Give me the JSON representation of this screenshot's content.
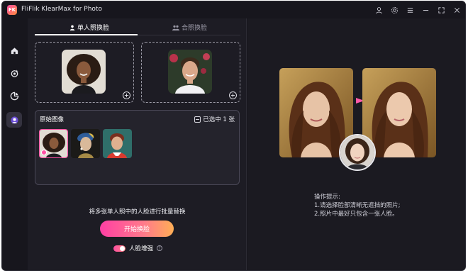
{
  "window": {
    "app_logo_text": "FK",
    "title": "FliFlik KlearMax for Photo",
    "title_icons": [
      "user-icon",
      "gear-icon",
      "menu-icon",
      "minimize-icon",
      "maximize-icon",
      "close-icon"
    ]
  },
  "sidebar": {
    "items": [
      {
        "name": "home",
        "icon": "home-icon",
        "active": false
      },
      {
        "name": "enhance",
        "icon": "enhance-icon",
        "active": false
      },
      {
        "name": "colorize",
        "icon": "palette-icon",
        "active": false
      },
      {
        "name": "face-swap",
        "icon": "face-swap-icon",
        "active": true
      }
    ]
  },
  "tabs": {
    "single": "单人照换脸",
    "group": "合照换脸"
  },
  "original_images": {
    "title": "原始图像",
    "selected_text": "已选中 1 张"
  },
  "actions": {
    "batch_text": "将多张单人照中的人脸进行批量替换",
    "start_button": "开始换脸",
    "enhance_label": "人脸增强",
    "enhance_on": true,
    "help": "?"
  },
  "tips": {
    "title": "操作提示:",
    "line1": "1.请选择脸部清晰无遮挡的照片;",
    "line2": "2.照片中最好只包含一张人脸。"
  },
  "colors": {
    "accent_start": "#ff3fa4",
    "accent_end": "#ffae55",
    "background": "#17161d"
  }
}
